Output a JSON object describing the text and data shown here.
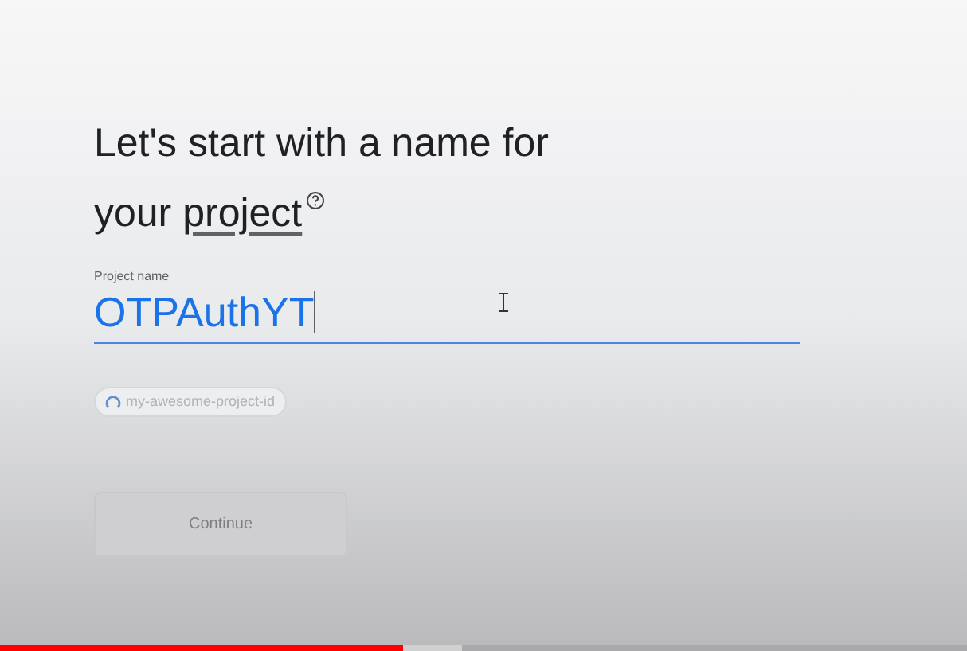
{
  "heading": {
    "text": "Let's start with a name for your",
    "link": "project"
  },
  "project_name": {
    "label": "Project name",
    "value": "OTPAuthYT",
    "focused": true
  },
  "project_id": {
    "text": "my-awesome-project-id",
    "loading": true
  },
  "continue_button": {
    "label": "Continue",
    "disabled": true
  },
  "video_progress": {
    "level": 0.417
  }
}
